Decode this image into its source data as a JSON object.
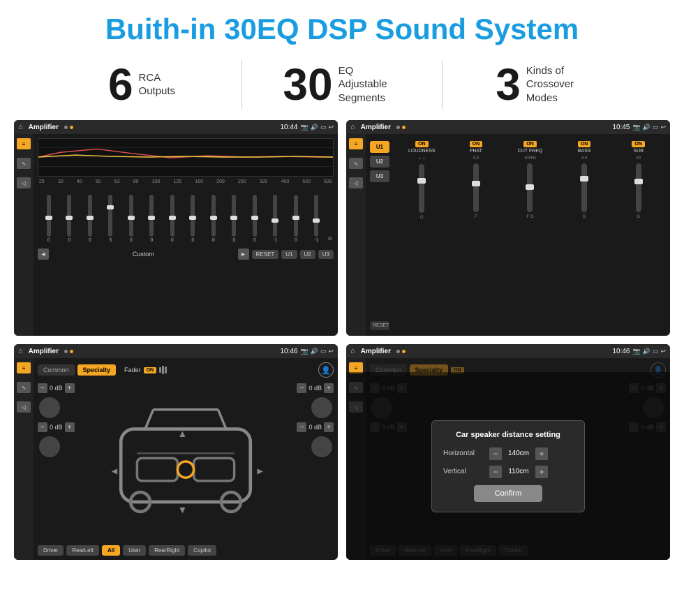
{
  "header": {
    "title": "Buith-in 30EQ DSP Sound System"
  },
  "stats": [
    {
      "number": "6",
      "label": "RCA\nOutputs"
    },
    {
      "number": "30",
      "label": "EQ Adjustable\nSegments"
    },
    {
      "number": "3",
      "label": "Kinds of\nCrossover Modes"
    }
  ],
  "screens": {
    "top_left": {
      "status_bar": {
        "app": "Amplifier",
        "time": "10:44"
      },
      "eq_freqs": [
        "25",
        "32",
        "40",
        "50",
        "63",
        "80",
        "100",
        "125",
        "160",
        "200",
        "250",
        "320",
        "400",
        "500",
        "630"
      ],
      "eq_values": [
        "0",
        "0",
        "0",
        "5",
        "0",
        "0",
        "0",
        "0",
        "0",
        "0",
        "0",
        "-1",
        "0",
        "-1"
      ],
      "eq_mode": "Custom",
      "buttons": [
        "RESET",
        "U1",
        "U2",
        "U3"
      ]
    },
    "top_right": {
      "status_bar": {
        "app": "Amplifier",
        "time": "10:45"
      },
      "presets": [
        "U1",
        "U2",
        "U3"
      ],
      "channels": [
        {
          "name": "LOUDNESS",
          "on": true
        },
        {
          "name": "PHAT",
          "on": true
        },
        {
          "name": "CUT FREQ",
          "on": true
        },
        {
          "name": "BASS",
          "on": true
        },
        {
          "name": "SUB",
          "on": true
        }
      ]
    },
    "bottom_left": {
      "status_bar": {
        "app": "Amplifier",
        "time": "10:46"
      },
      "tabs": [
        "Common",
        "Specialty"
      ],
      "fader_label": "Fader",
      "fader_on": true,
      "db_values": [
        "0 dB",
        "0 dB",
        "0 dB",
        "0 dB"
      ],
      "buttons": [
        "Driver",
        "RearLeft",
        "All",
        "User",
        "RearRight",
        "Copilot"
      ]
    },
    "bottom_right": {
      "status_bar": {
        "app": "Amplifier",
        "time": "10:46"
      },
      "tabs": [
        "Common",
        "Specialty"
      ],
      "dialog": {
        "title": "Car speaker distance setting",
        "horizontal_label": "Horizontal",
        "horizontal_value": "140cm",
        "vertical_label": "Vertical",
        "vertical_value": "110cm",
        "confirm_label": "Confirm"
      },
      "db_values": [
        "0 dB",
        "0 dB"
      ],
      "buttons": [
        "Driver",
        "RearLeft",
        "User",
        "RearRight",
        "Copilot"
      ]
    }
  }
}
